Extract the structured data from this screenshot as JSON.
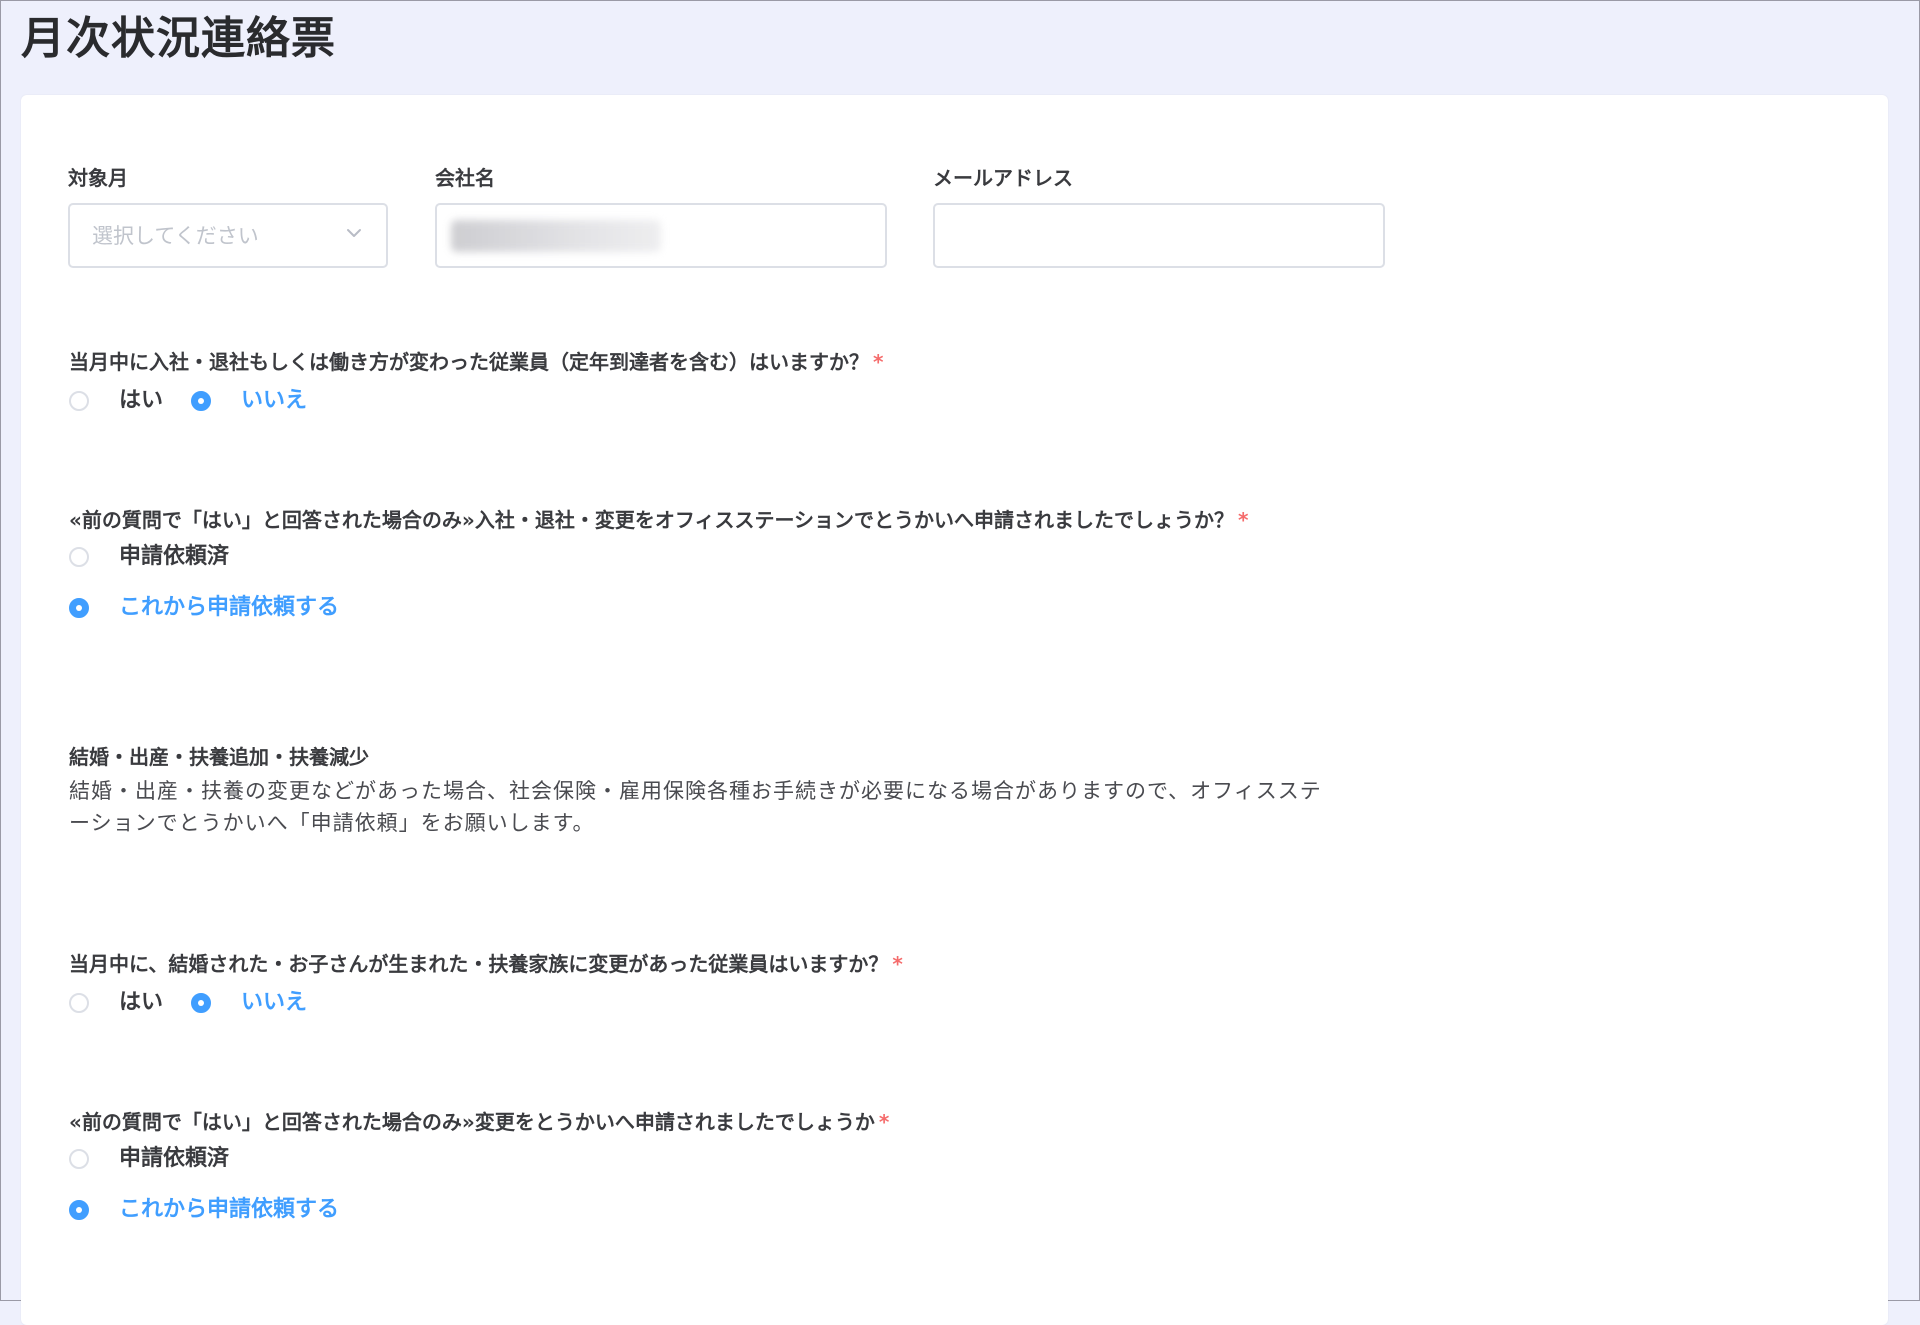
{
  "page": {
    "title": "月次状況連絡票"
  },
  "form": {
    "month": {
      "label": "対象月",
      "placeholder": "選択してください"
    },
    "company": {
      "label": "会社名",
      "value_redacted": true
    },
    "email": {
      "label": "メールアドレス",
      "value": ""
    },
    "q1": {
      "text": "当月中に入社・退社もしくは働き方が変わった従業員（定年到達者を含む）はいますか？",
      "required_mark": "*",
      "options": [
        "はい",
        "いいえ"
      ],
      "selected": "いいえ"
    },
    "q2": {
      "text": "«前の質問で「はい」と回答された場合のみ»入社・退社・変更をオフィスステーションでとうかいへ申請されましたでしょうか？",
      "required_mark": "*",
      "options": [
        "申請依頼済",
        "これから申請依頼する"
      ],
      "selected": "これから申請依頼する"
    },
    "section": {
      "title": "結婚・出産・扶養追加・扶養減少",
      "description": "結婚・出産・扶養の変更などがあった場合、社会保険・雇用保険各種お手続きが必要になる場合がありますので、オフィスステーションでとうかいへ「申請依頼」をお願いします。"
    },
    "q3": {
      "text": "当月中に、結婚された・お子さんが生まれた・扶養家族に変更があった従業員はいますか？",
      "required_mark": "*",
      "options": [
        "はい",
        "いいえ"
      ],
      "selected": "いいえ"
    },
    "q4": {
      "text": "«前の質問で「はい」と回答された場合のみ»変更をとうかいへ申請されましたでしょうか",
      "required_mark": "*",
      "options": [
        "申請依頼済",
        "これから申請依頼する"
      ],
      "selected": "これから申請依頼する"
    }
  },
  "colors": {
    "accent": "#409eff",
    "required": "#f56c6c",
    "page_background": "#eef0fc",
    "card_background": "#ffffff",
    "border": "#dcdfe6"
  }
}
